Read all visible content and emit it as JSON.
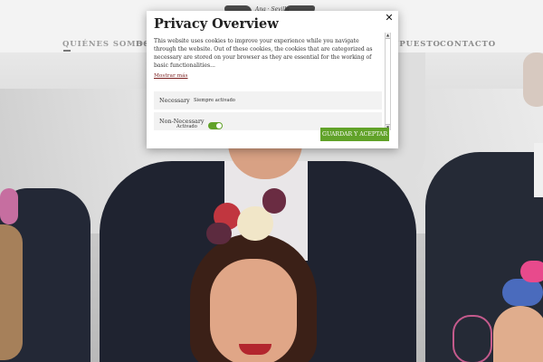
{
  "site": {
    "logo_tagline": "Ana · Sevilla",
    "nav": [
      {
        "label": "QUIÉNES SOMOS"
      },
      {
        "label": "BO"
      },
      {
        "label": "UPUESTO"
      },
      {
        "label": "CONTACTO"
      }
    ]
  },
  "cookie_modal": {
    "title": "Privacy Overview",
    "close_symbol": "✕",
    "description": "This website uses cookies to improve your experience while you navigate through the website. Out of these cookies, the cookies that are categorized as necessary are stored on your browser as they are essential for the working of basic functionalities...",
    "more_link": "Mostrar más",
    "categories": [
      {
        "name": "Necessary",
        "status": "Siempre activado"
      },
      {
        "name": "Non-Necessary",
        "status": "Activado",
        "toggle_on": true
      }
    ],
    "accept_button": "GUARDAR Y ACEPTAR"
  },
  "colors": {
    "accent_green": "#61a229",
    "link_red": "#7a1f1f",
    "nav_gray": "#8a8a8a"
  },
  "icons": {
    "close": "close-icon",
    "scroll_up": "scroll-up-arrow-icon",
    "scroll_down": "scroll-down-arrow-icon",
    "toggle": "toggle-switch-icon"
  }
}
